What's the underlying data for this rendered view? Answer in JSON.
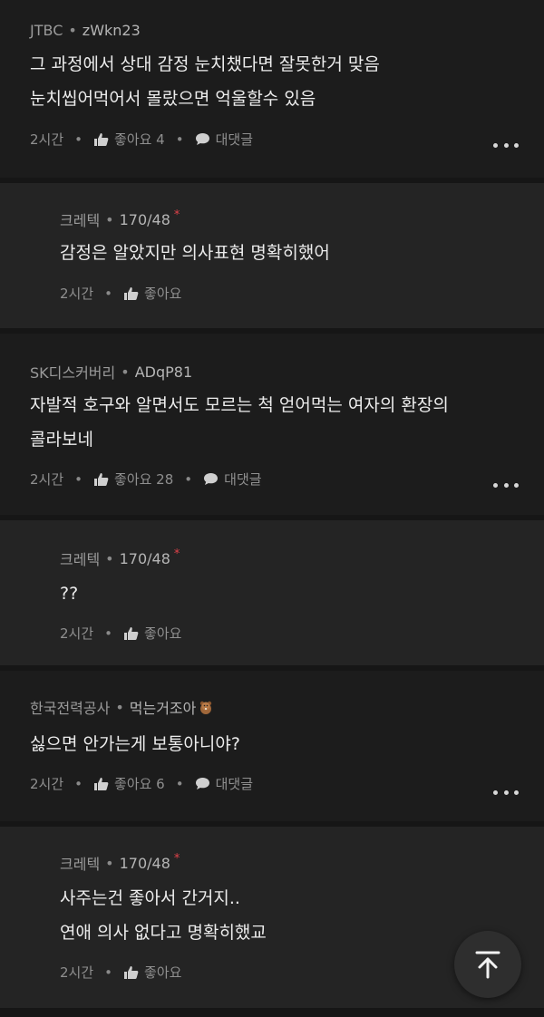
{
  "comments": [
    {
      "author": "JTBC",
      "nickname": "zWkn23",
      "lines": [
        "그 과정에서 상대 감정 눈치챘다면 잘못한거 맞음",
        "눈치씹어먹어서 몰랐으면 억울할수 있음"
      ],
      "time": "2시간",
      "like_label": "좋아요 4",
      "reply_label": "대댓글"
    },
    {
      "author": "크레텍",
      "nickname": "170/48",
      "lines": [
        "감정은 알았지만 의사표현 명확히했어"
      ],
      "time": "2시간",
      "like_label": "좋아요"
    },
    {
      "author": "SK디스커버리",
      "nickname": "ADqP81",
      "lines": [
        "자발적 호구와 알면서도 모르는 척 얻어먹는 여자의 환장의",
        "콜라보네"
      ],
      "time": "2시간",
      "like_label": "좋아요 28",
      "reply_label": "대댓글"
    },
    {
      "author": "크레텍",
      "nickname": "170/48",
      "lines": [
        "??"
      ],
      "time": "2시간",
      "like_label": "좋아요"
    },
    {
      "author": "한국전력공사",
      "nickname": "먹는거조아",
      "lines": [
        "싫으면 안가는게 보통아니야?"
      ],
      "time": "2시간",
      "like_label": "좋아요 6",
      "reply_label": "대댓글"
    },
    {
      "author": "크레텍",
      "nickname": "170/48",
      "lines": [
        "사주는건 좋아서 간거지..",
        "연애 의사 없다고 명확히했교"
      ],
      "time": "2시간",
      "like_label": "좋아요"
    }
  ],
  "icons": {
    "like": "thumbs-up-icon",
    "reply": "chat-bubble-icon",
    "more": "more-dots-icon",
    "scroll_top": "arrow-up-to-top-icon",
    "badge": "beaver-emoji-icon"
  },
  "colors": {
    "background": "#161616",
    "reply_background": "#242424",
    "op_star": "#e0424a"
  }
}
